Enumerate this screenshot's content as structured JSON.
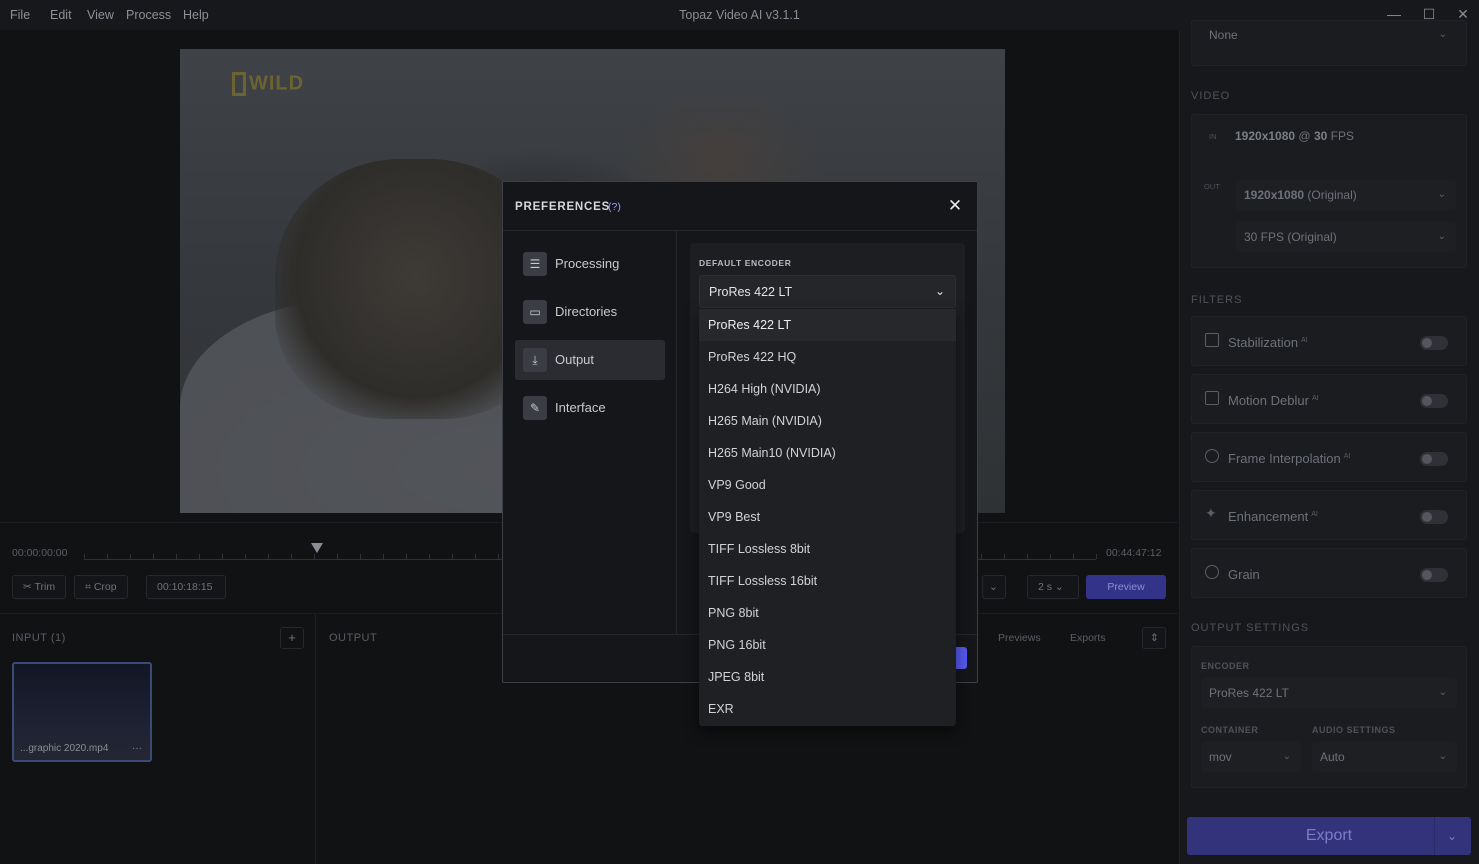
{
  "titlebar": {
    "menu": [
      "File",
      "Edit",
      "View",
      "Process",
      "Help"
    ],
    "title": "Topaz Video AI  v3.1.1"
  },
  "video": {
    "logo_text": "WILD"
  },
  "timeline": {
    "start_time": "00:00:00:00",
    "end_time": "00:44:47:12",
    "trim_label": "Trim",
    "crop_label": "Crop",
    "current_time": "00:10:18:15",
    "duration_select": "2 s",
    "preview_label": "Preview"
  },
  "input_pane": {
    "title": "INPUT (1)",
    "add_label": "+",
    "file_name": "...graphic 2020.mp4",
    "more": "···"
  },
  "output_pane": {
    "title": "OUTPUT",
    "tabs": [
      "Previews",
      "Exports"
    ]
  },
  "right_panel": {
    "top_select": "None",
    "video_section": "VIDEO",
    "in_tag": "IN",
    "in_res": "1920x1080",
    "in_at": "@",
    "in_fps": "30",
    "in_fps_unit": "FPS",
    "out_tag": "OUT",
    "out_res": "1920x1080",
    "out_res_note": "(Original)",
    "out_fps": "30 FPS (Original)",
    "filters_section": "FILTERS",
    "filters": [
      {
        "label": "Stabilization",
        "ai": "AI"
      },
      {
        "label": "Motion Deblur",
        "ai": "AI"
      },
      {
        "label": "Frame Interpolation",
        "ai": "AI"
      },
      {
        "label": "Enhancement",
        "ai": "AI"
      },
      {
        "label": "Grain",
        "ai": ""
      }
    ],
    "output_section": "OUTPUT SETTINGS",
    "encoder_label": "ENCODER",
    "encoder_value": "ProRes 422 LT",
    "container_label": "CONTAINER",
    "container_value": "mov",
    "audio_label": "AUDIO SETTINGS",
    "audio_value": "Auto",
    "export_label": "Export"
  },
  "dialog": {
    "title": "PREFERENCES",
    "help": "(?)",
    "close": "✕",
    "nav": [
      {
        "label": "Processing",
        "icon": "sliders-icon"
      },
      {
        "label": "Directories",
        "icon": "folder-icon"
      },
      {
        "label": "Output",
        "icon": "download-icon"
      },
      {
        "label": "Interface",
        "icon": "edit-icon"
      }
    ],
    "active_nav": "Output",
    "default_encoder_label": "DEFAULT ENCODER",
    "default_encoder_value": "ProRes 422 LT",
    "encoder_options": [
      "ProRes 422 LT",
      "ProRes 422 HQ",
      "H264 High (NVIDIA)",
      "H265 Main (NVIDIA)",
      "H265 Main10 (NVIDIA)",
      "VP9 Good",
      "VP9 Best",
      "TIFF Lossless 8bit",
      "TIFF Lossless 16bit",
      "PNG 8bit",
      "PNG 16bit",
      "JPEG 8bit",
      "EXR"
    ]
  },
  "colors": {
    "accent": "#5559f0",
    "background": "#111214",
    "panel": "#17181b"
  }
}
